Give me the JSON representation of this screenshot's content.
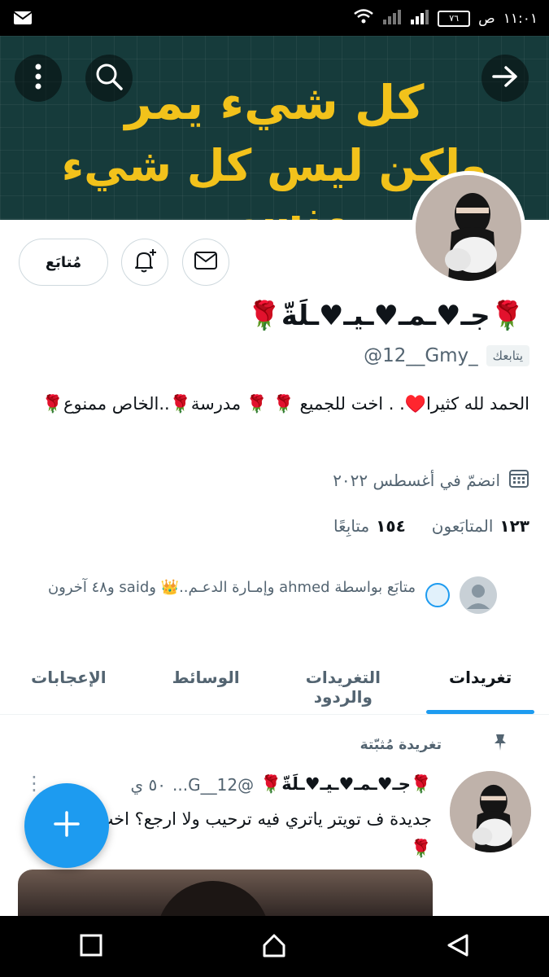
{
  "status_bar": {
    "time": "١١:٠١",
    "period": "ص",
    "battery": "٧٦"
  },
  "header": {
    "banner_line1": "كل شيء يمر",
    "banner_line2": "ولكن ليس كل شيء منسي."
  },
  "profile": {
    "display_name": "🌹جـ♥ـمـ♥ـيـ♥ـلَةّ🌹",
    "handle": "@12__Gmy_",
    "follows_you": "يتابعك",
    "bio": "الحمد لله كثيرا♥️. . اخت للجميع 🌹    🌹  مدرسة🌹..الخاص ممنوع🌹",
    "joined": "انضمّ في أغسطس ٢٠٢٢",
    "following_count": "١٢٣",
    "following_label": "المتابَعون",
    "followers_count": "١٥٤",
    "followers_label": "متابِعًا",
    "followed_by": "متابَع بواسطة ahmed وإمـارة الدعـم..👑 وsaid و٤٨ آخرون"
  },
  "actions": {
    "follow_label": "مُتابَع"
  },
  "tabs": [
    {
      "label": "تغريدات"
    },
    {
      "label": "التغريدات والردود"
    },
    {
      "label": "الوسائط"
    },
    {
      "label": "الإعجابات"
    }
  ],
  "pinned": {
    "label": "تغريدة مُثبّتة",
    "author": "🌹جـ♥ـمـ♥ـيـ♥ـلَةّ🌹",
    "handle": "@12__G...",
    "time": "٥٠ ي",
    "text": "جديدة ف تويتر ياتري فيه ترحيب ولا ارجع؟ اخت للجميع .🌹"
  },
  "colors": {
    "accent": "#1d9bf0",
    "banner_bg": "#163b3b",
    "banner_text": "#f2c21b"
  }
}
